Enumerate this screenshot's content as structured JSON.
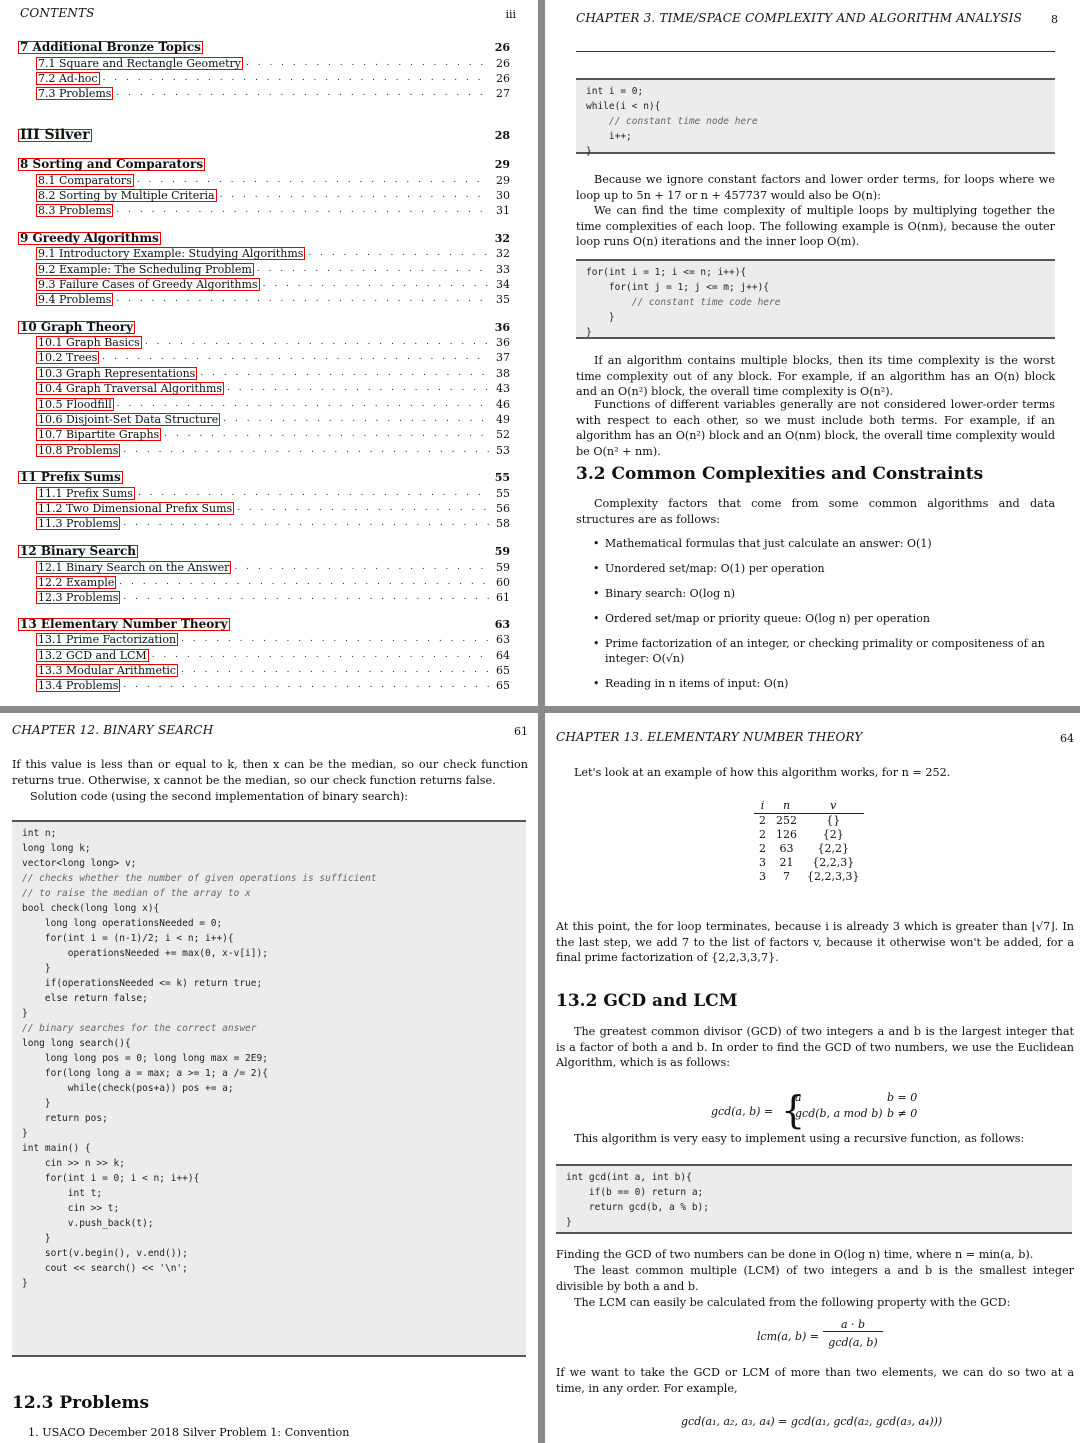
{
  "toc": {
    "header": "CONTENTS",
    "page_number": "iii",
    "rows": [
      {
        "kind": "ch",
        "label": "7  Additional Bronze Topics",
        "page": "26",
        "boxed": true
      },
      {
        "kind": "sec",
        "label": "7.1  Square and Rectangle Geometry",
        "page": "26",
        "boxed": true
      },
      {
        "kind": "sec",
        "label": "7.2  Ad-hoc",
        "page": "26",
        "boxed": true
      },
      {
        "kind": "sec",
        "label": "7.3  Problems",
        "page": "27",
        "boxed": true
      },
      {
        "kind": "part",
        "label": "III  Silver",
        "page": "28",
        "boxed": true
      },
      {
        "kind": "ch",
        "label": "8  Sorting and Comparators",
        "page": "29",
        "boxed": true
      },
      {
        "kind": "sec",
        "label": "8.1  Comparators",
        "page": "29",
        "boxed": true
      },
      {
        "kind": "sec",
        "label": "8.2  Sorting by Multiple Criteria",
        "page": "30",
        "boxed": true
      },
      {
        "kind": "sec",
        "label": "8.3  Problems",
        "page": "31",
        "boxed": true
      },
      {
        "kind": "ch",
        "label": "9  Greedy Algorithms",
        "page": "32",
        "boxed": true
      },
      {
        "kind": "sec",
        "label": "9.1  Introductory Example: Studying Algorithms",
        "page": "32",
        "boxed": true
      },
      {
        "kind": "sec",
        "label": "9.2  Example: The Scheduling Problem",
        "page": "33",
        "boxed": true
      },
      {
        "kind": "sec",
        "label": "9.3  Failure Cases of Greedy Algorithms",
        "page": "34",
        "boxed": true
      },
      {
        "kind": "sec",
        "label": "9.4  Problems",
        "page": "35",
        "boxed": true
      },
      {
        "kind": "ch",
        "label": "10 Graph Theory",
        "page": "36",
        "boxed": true
      },
      {
        "kind": "sec",
        "label": "10.1 Graph Basics",
        "page": "36",
        "boxed": true
      },
      {
        "kind": "sec",
        "label": "10.2 Trees",
        "page": "37",
        "boxed": true
      },
      {
        "kind": "sec",
        "label": "10.3 Graph Representations",
        "page": "38",
        "boxed": true
      },
      {
        "kind": "sec",
        "label": "10.4 Graph Traversal Algorithms",
        "page": "43",
        "boxed": true
      },
      {
        "kind": "sec",
        "label": "10.5 Floodfill",
        "page": "46",
        "boxed": true
      },
      {
        "kind": "sec",
        "label": "10.6 Disjoint-Set Data Structure",
        "page": "49",
        "boxed": true
      },
      {
        "kind": "sec",
        "label": "10.7 Bipartite Graphs",
        "page": "52",
        "boxed": true
      },
      {
        "kind": "sec",
        "label": "10.8 Problems",
        "page": "53",
        "boxed": true
      },
      {
        "kind": "ch",
        "label": "11 Prefix Sums",
        "page": "55",
        "boxed": true
      },
      {
        "kind": "sec",
        "label": "11.1 Prefix Sums",
        "page": "55",
        "boxed": true
      },
      {
        "kind": "sec",
        "label": "11.2 Two Dimensional Prefix Sums",
        "page": "56",
        "boxed": true
      },
      {
        "kind": "sec",
        "label": "11.3 Problems",
        "page": "58",
        "boxed": true
      },
      {
        "kind": "ch",
        "label": "12 Binary Search",
        "page": "59",
        "boxed": true
      },
      {
        "kind": "sec",
        "label": "12.1 Binary Search on the Answer",
        "page": "59",
        "boxed": true
      },
      {
        "kind": "sec",
        "label": "12.2 Example",
        "page": "60",
        "boxed": true
      },
      {
        "kind": "sec",
        "label": "12.3 Problems",
        "page": "61",
        "boxed": true
      },
      {
        "kind": "ch",
        "label": "13 Elementary Number Theory",
        "page": "63",
        "boxed": true
      },
      {
        "kind": "sec",
        "label": "13.1 Prime Factorization",
        "page": "63",
        "boxed": true
      },
      {
        "kind": "sec",
        "label": "13.2 GCD and LCM",
        "page": "64",
        "boxed": true
      },
      {
        "kind": "sec",
        "label": "13.3 Modular Arithmetic",
        "page": "65",
        "boxed": true
      },
      {
        "kind": "sec",
        "label": "13.4 Problems",
        "page": "65",
        "boxed": true
      }
    ]
  },
  "ch3": {
    "header": "CHAPTER 3.  TIME/SPACE COMPLEXITY AND ALGORITHM ANALYSIS",
    "page_number": "8",
    "code1": [
      "int i = 0;",
      "while(i < n){",
      "    // constant time node here",
      "    i++;",
      "}"
    ],
    "para1": "Because we ignore constant factors and lower order terms, for loops where we loop up to 5n + 17 or n + 457737 would also be O(n):",
    "para2": "We can find the time complexity of multiple loops by multiplying together the time complexities of each loop. The following example is O(nm), because the outer loop runs O(n) iterations and the inner loop O(m).",
    "code2": [
      "for(int i = 1; i <= n; i++){",
      "    for(int j = 1; j <= m; j++){",
      "        // constant time code here",
      "    }",
      "}"
    ],
    "para3": "If an algorithm contains multiple blocks, then its time complexity is the worst time complexity out of any block. For example, if an algorithm has an O(n) block and an O(n²) block, the overall time complexity is O(n²).",
    "para4": "Functions of different variables generally are not considered lower-order terms with respect to each other, so we must include both terms. For example, if an algorithm has an O(n²) block and an O(nm) block, the overall time complexity would be O(n² + nm).",
    "section_title": "3.2   Common Complexities and Constraints",
    "para5": "Complexity factors that come from some common algorithms and data structures are as follows:",
    "bullets": [
      "Mathematical formulas that just calculate an answer: O(1)",
      "Unordered set/map: O(1) per operation",
      "Binary search: O(log n)",
      "Ordered set/map or priority queue: O(log n) per operation",
      "Prime factorization of an integer, or checking primality or compositeness of an integer: O(√n)",
      "Reading in n items of input: O(n)"
    ]
  },
  "ch12": {
    "header": "CHAPTER 12.  BINARY SEARCH",
    "page_number": "61",
    "para1": "If this value is less than or equal to k, then x can be the median, so our check function returns true. Otherwise, x cannot be the median, so our check function returns false.",
    "para2": "Solution code (using the second implementation of binary search):",
    "code": [
      "int n;",
      "long long k;",
      "vector<long long> v;",
      "",
      "// checks whether the number of given operations is sufficient",
      "// to raise the median of the array to x",
      "bool check(long long x){",
      "    long long operationsNeeded = 0;",
      "    for(int i = (n-1)/2; i < n; i++){",
      "        operationsNeeded += max(0, x-v[i]);",
      "    }",
      "    if(operationsNeeded <= k) return true;",
      "    else return false;",
      "}",
      "",
      "// binary searches for the correct answer",
      "long long search(){",
      "    long long pos = 0; long long max = 2E9;",
      "    for(long long a = max; a >= 1; a /= 2){",
      "        while(check(pos+a)) pos += a;",
      "    }",
      "    return pos;",
      "}",
      "",
      "int main() {",
      "    cin >> n >> k;",
      "    for(int i = 0; i < n; i++){",
      "        int t;",
      "        cin >> t;",
      "        v.push_back(t);",
      "    }",
      "    sort(v.begin(), v.end());",
      "",
      "    cout << search() << '\\n';",
      "}"
    ],
    "section_title": "12.3   Problems",
    "problem1": "1.  USACO December 2018 Silver Problem 1: Convention"
  },
  "ch13": {
    "header": "CHAPTER 13.  ELEMENTARY NUMBER THEORY",
    "page_number": "64",
    "para1": "Let's look at an example of how this algorithm works, for n = 252.",
    "table_head": [
      "i",
      "n",
      "v"
    ],
    "table_rows": [
      [
        "2",
        "252",
        "{}"
      ],
      [
        "2",
        "126",
        "{2}"
      ],
      [
        "2",
        "63",
        "{2,2}"
      ],
      [
        "3",
        "21",
        "{2,2,3}"
      ],
      [
        "3",
        "7",
        "{2,2,3,3}"
      ]
    ],
    "para2": "At this point, the for loop terminates, because i is already 3 which is greater than ⌊√7⌋. In the last step, we add 7 to the list of factors v, because it otherwise won't be added, for a final prime factorization of {2,2,3,3,7}.",
    "section_title": "13.2   GCD and LCM",
    "para3": "The greatest common divisor (GCD) of two integers a and b is the largest integer that is a factor of both a and b. In order to find the GCD of two numbers, we use the Euclidean Algorithm, which is as follows:",
    "gcd_lhs": "gcd(a, b) =",
    "gcd_case1": "a",
    "gcd_cond1": "b = 0",
    "gcd_case2": "gcd(b, a mod b)",
    "gcd_cond2": "b ≠ 0",
    "para4": "This algorithm is very easy to implement using a recursive function, as follows:",
    "code": [
      "int gcd(int a, int b){",
      "    if(b == 0) return a;",
      "    return gcd(b, a % b);",
      "}"
    ],
    "para5": "Finding the GCD of two numbers can be done in O(log n) time, where n = min(a, b).",
    "para6": "The least common multiple (LCM) of two integers a and b is the smallest integer divisible by both a and b.",
    "para7": "The LCM can easily be calculated from the following property with the GCD:",
    "lcm_lhs": "lcm(a, b) =",
    "lcm_num": "a · b",
    "lcm_den": "gcd(a, b)",
    "para8": "If we want to take the GCD or LCM of more than two elements, we can do so two at a time, in any order. For example,",
    "final_formula": "gcd(a₁, a₂, a₃, a₄) = gcd(a₁, gcd(a₂, gcd(a₃, a₄)))"
  }
}
